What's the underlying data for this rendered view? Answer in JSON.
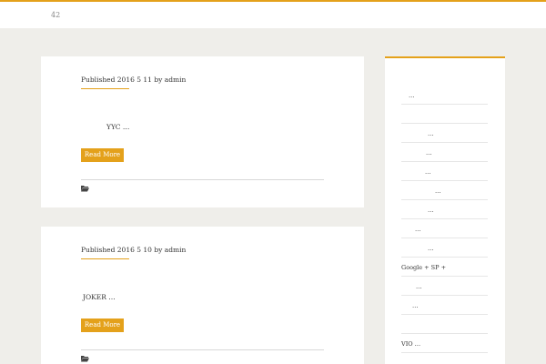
{
  "header": {
    "number": "42"
  },
  "posts": [
    {
      "meta": "Published 2016 5 11  by admin",
      "excerpt": "YYC      …",
      "button": "Read More"
    },
    {
      "meta": "Published 2016 5 10  by admin",
      "excerpt": "JOKER            …",
      "button": "Read More"
    }
  ],
  "sidebar": {
    "items": [
      {
        "text": "…"
      },
      {
        "text": ""
      },
      {
        "text": "…"
      },
      {
        "text": "…"
      },
      {
        "text": "…"
      },
      {
        "text": "…"
      },
      {
        "text": "…"
      },
      {
        "text": "…"
      },
      {
        "text": "…"
      },
      {
        "text": "Google + SP +"
      },
      {
        "text": "…"
      },
      {
        "text": "…"
      },
      {
        "text": ""
      },
      {
        "text": "VIO             …"
      },
      {
        "text": "…"
      }
    ]
  },
  "colors": {
    "accent": "#e4a11b",
    "background": "#efeeea"
  }
}
